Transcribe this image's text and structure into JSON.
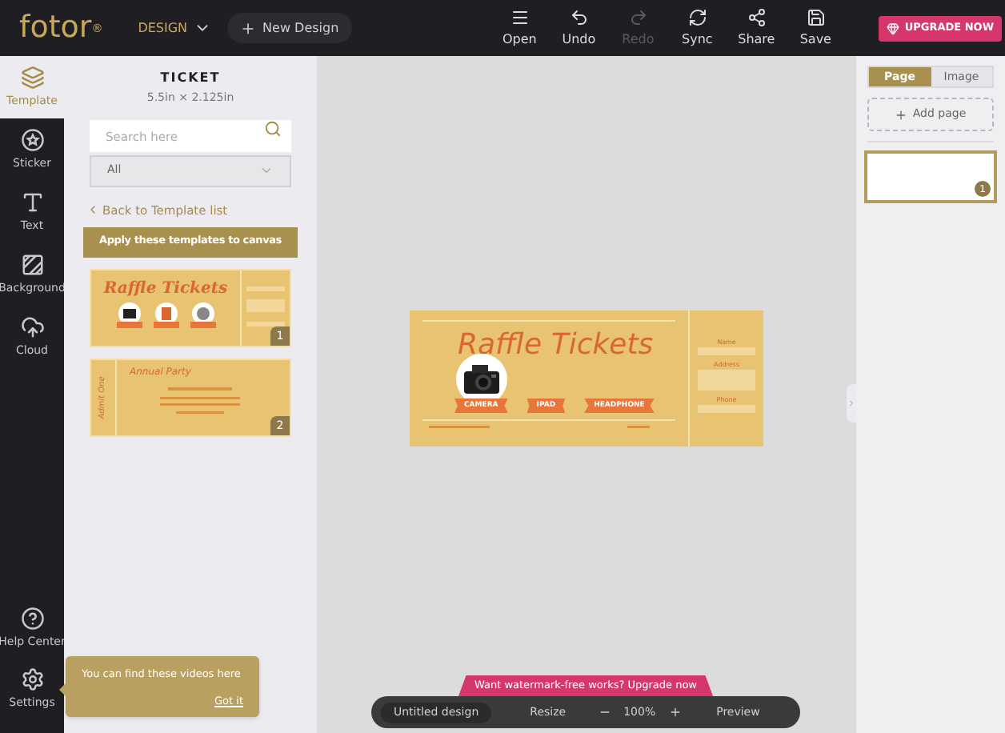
{
  "logo": "fotor",
  "logo_mark": "®",
  "top_bar": {
    "menu_label": "DESIGN",
    "new_design": "New Design",
    "tools": [
      {
        "kind": "open",
        "label": "Open",
        "disabled": false
      },
      {
        "kind": "undo",
        "label": "Undo",
        "disabled": false
      },
      {
        "kind": "redo",
        "label": "Redo",
        "disabled": true
      },
      {
        "kind": "sync",
        "label": "Sync",
        "disabled": false
      },
      {
        "kind": "share",
        "label": "Share",
        "disabled": false
      },
      {
        "kind": "save",
        "label": "Save",
        "disabled": false
      }
    ],
    "upgrade": "UPGRADE NOW"
  },
  "rail": {
    "items": [
      {
        "kind": "template",
        "label": "Template",
        "selected": true
      },
      {
        "kind": "sticker",
        "label": "Sticker",
        "selected": false
      },
      {
        "kind": "text",
        "label": "Text",
        "selected": false
      },
      {
        "kind": "background",
        "label": "Background",
        "selected": false
      },
      {
        "kind": "cloud",
        "label": "Cloud",
        "selected": false
      }
    ],
    "bottom_items": [
      {
        "kind": "help",
        "label": "Help Center"
      },
      {
        "kind": "settings",
        "label": "Settings"
      }
    ]
  },
  "panel": {
    "title": "TICKET",
    "size": "5.5in × 2.125in",
    "search": {
      "placeholder": "Search here"
    },
    "filter": "All",
    "back_link": "Back to Template list",
    "apply_button": "Apply these templates to canvas",
    "templates": [
      {
        "kind": "raffle",
        "title": "Raffle Tickets",
        "number": "1"
      },
      {
        "kind": "party",
        "title": "Annual Party",
        "side": "Admit One",
        "number": "2"
      }
    ]
  },
  "canvas": {
    "ticket": {
      "title": "Raffle Tickets",
      "prizes": [
        "CAMERA",
        "IPAD",
        "HEADPHONE"
      ],
      "fields": [
        {
          "kind": "line",
          "label": "Name"
        },
        {
          "kind": "box",
          "label": "Address"
        },
        {
          "kind": "line",
          "label": "Phone"
        }
      ]
    }
  },
  "right_panel": {
    "tabs": [
      {
        "label": "Page",
        "selected": true
      },
      {
        "label": "Image",
        "selected": false
      }
    ],
    "add_page": "Add page",
    "pages": [
      {
        "number": "1",
        "selected": true
      }
    ]
  },
  "tooltip": {
    "text": "You can find these videos here",
    "action": "Got it"
  },
  "upgrade_banner": "Want watermark-free works? Upgrade now",
  "bottom_bar": {
    "design_name": "Untitled design",
    "resize": "Resize",
    "zoom": "100%",
    "preview": "Preview"
  }
}
